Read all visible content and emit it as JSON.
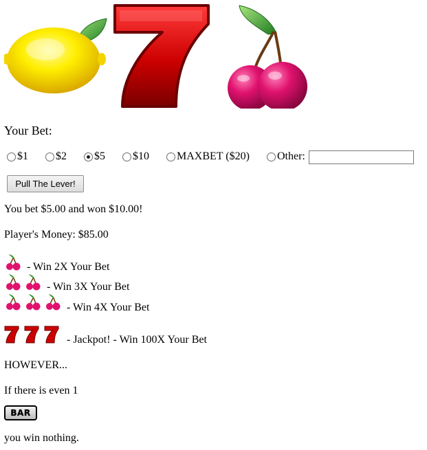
{
  "reels": [
    {
      "symbol": "lemon-icon"
    },
    {
      "symbol": "seven-icon"
    },
    {
      "symbol": "cherry-icon"
    }
  ],
  "bet": {
    "title": "Your Bet:",
    "options": [
      {
        "label": "$1",
        "checked": false
      },
      {
        "label": "$2",
        "checked": false
      },
      {
        "label": "$5",
        "checked": true
      },
      {
        "label": "$10",
        "checked": false
      },
      {
        "label": "MAXBET ($20)",
        "checked": false
      },
      {
        "label": "Other:",
        "checked": false
      }
    ],
    "other_value": ""
  },
  "lever_button_label": "Pull The Lever!",
  "result_text": "You bet $5.00 and won $10.00!",
  "money_text": "Player's Money: $85.00",
  "rules": {
    "cherry1": "- Win 2X Your Bet",
    "cherry2": "- Win 3X Your Bet",
    "cherry3": "- Win 4X Your Bet",
    "jackpot": "- Jackpot! - Win 100X Your Bet",
    "however": "HOWEVER...",
    "if_even": "If there is even 1",
    "bar_label": "BAR",
    "win_nothing": "you win nothing."
  },
  "colors": {
    "seven_red": "#cc0000",
    "cherry_pink": "#e0126e",
    "lemon_yellow": "#ffe600",
    "leaf_green": "#3aa02a"
  }
}
